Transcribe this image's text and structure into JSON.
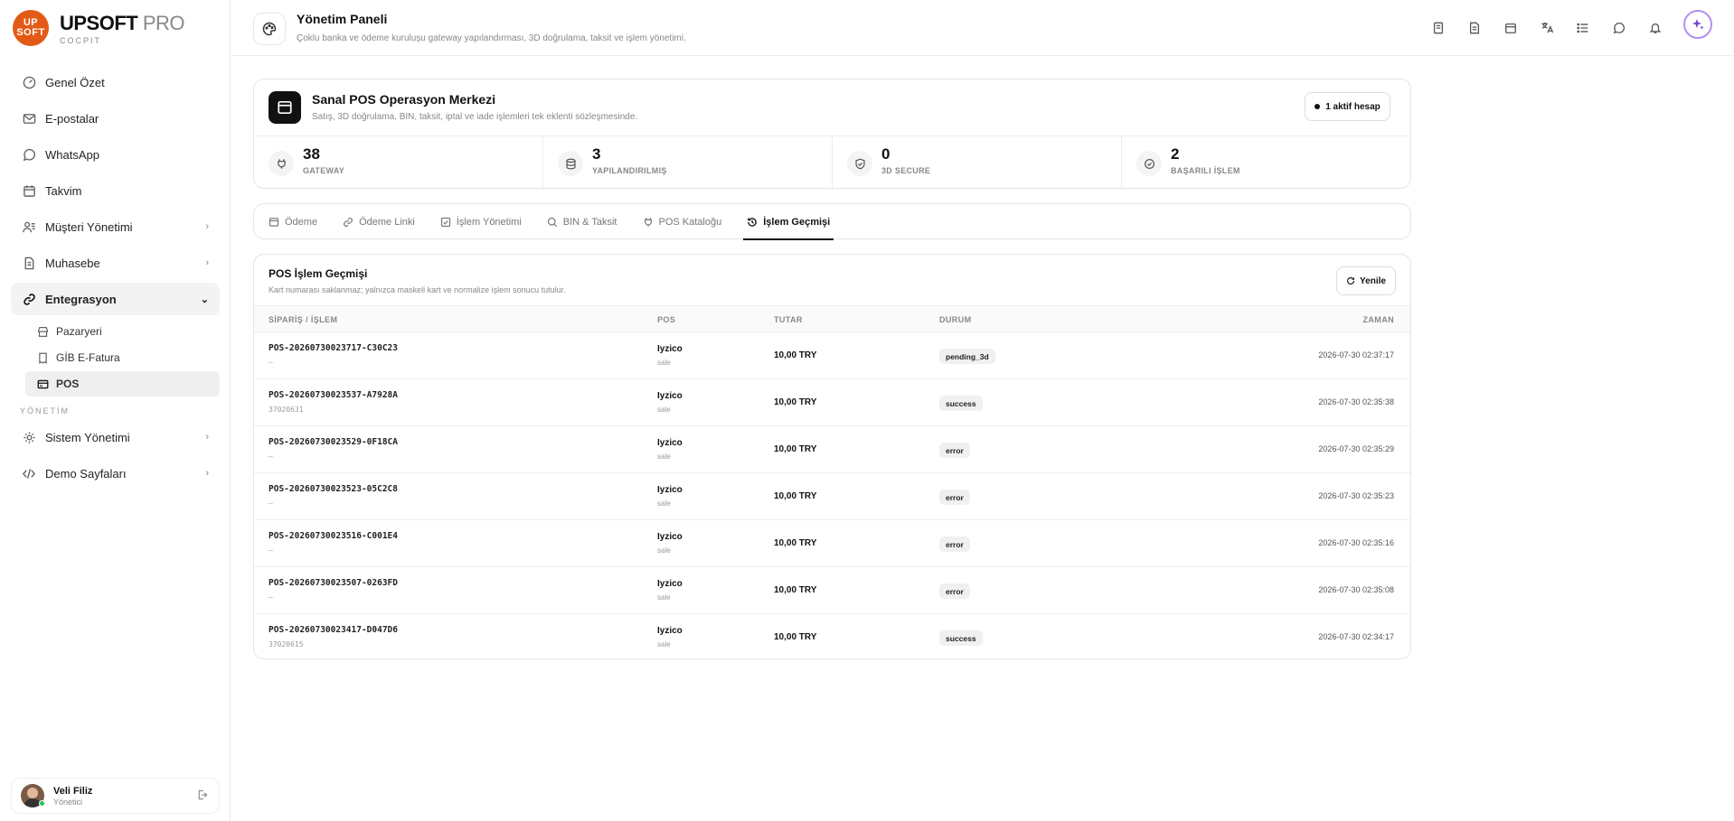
{
  "brand": {
    "logo_top": "UP",
    "logo_bottom": "SOFT",
    "name": "UPSOFT",
    "name_suffix": "PRO",
    "subtitle": "COCPIT"
  },
  "sidebar": {
    "items": [
      {
        "label": "Genel Özet",
        "icon": "gauge-icon"
      },
      {
        "label": "E-postalar",
        "icon": "mail-icon"
      },
      {
        "label": "WhatsApp",
        "icon": "whatsapp-icon"
      },
      {
        "label": "Takvim",
        "icon": "calendar-icon"
      },
      {
        "label": "Müşteri Yönetimi",
        "icon": "users-icon",
        "has_children": true
      },
      {
        "label": "Muhasebe",
        "icon": "document-icon",
        "has_children": true
      },
      {
        "label": "Entegrasyon",
        "icon": "link-icon",
        "expanded": true
      }
    ],
    "sub_items": [
      {
        "label": "Pazaryeri",
        "icon": "store-icon"
      },
      {
        "label": "GİB E-Fatura",
        "icon": "invoice-icon"
      },
      {
        "label": "POS",
        "icon": "card-icon",
        "active": true
      }
    ],
    "section_label": "YÖNETİM",
    "admin_items": [
      {
        "label": "Sistem Yönetimi",
        "icon": "gear-icon"
      },
      {
        "label": "Demo Sayfaları",
        "icon": "code-icon"
      }
    ]
  },
  "user": {
    "name": "Veli Filiz",
    "role": "Yönetici"
  },
  "topbar": {
    "title": "Yönetim Paneli",
    "subtitle": "Çoklu banka ve ödeme kuruluşu gateway yapılandırması, 3D doğrulama, taksit ve işlem yönetimi."
  },
  "hero": {
    "title": "Sanal POS Operasyon Merkezi",
    "subtitle": "Satış, 3D doğrulama, BIN, taksit, iptal ve iade işlemleri tek eklenti sözleşmesinde.",
    "badge": "1 aktif hesap",
    "stats": [
      {
        "value": "38",
        "label": "GATEWAY"
      },
      {
        "value": "3",
        "label": "YAPILANDIRILMIŞ"
      },
      {
        "value": "0",
        "label": "3D SECURE"
      },
      {
        "value": "2",
        "label": "BAŞARILI İŞLEM"
      }
    ]
  },
  "tabs": [
    {
      "label": "Ödeme"
    },
    {
      "label": "Ödeme Linki"
    },
    {
      "label": "İşlem Yönetimi"
    },
    {
      "label": "BIN & Taksit"
    },
    {
      "label": "POS Kataloğu"
    },
    {
      "label": "İşlem Geçmişi",
      "active": true
    }
  ],
  "history": {
    "title": "POS İşlem Geçmişi",
    "subtitle": "Kart numarası saklanmaz; yalnızca maskeli kart ve normalize işlem sonucu tutulur.",
    "refresh_label": "Yenile",
    "columns": {
      "order": "SİPARİŞ / İŞLEM",
      "pos": "POS",
      "amount": "TUTAR",
      "status": "DURUM",
      "time": "ZAMAN"
    },
    "rows": [
      {
        "order": "POS-20260730023717-C30C23",
        "sub": "–",
        "pos": "Iyzico",
        "type": "sale",
        "amount": "10,00 TRY",
        "status": "pending_3d",
        "time": "2026-07-30 02:37:17"
      },
      {
        "order": "POS-20260730023537-A7928A",
        "sub": "37020631",
        "pos": "Iyzico",
        "type": "sale",
        "amount": "10,00 TRY",
        "status": "success",
        "time": "2026-07-30 02:35:38"
      },
      {
        "order": "POS-20260730023529-0F18CA",
        "sub": "–",
        "pos": "Iyzico",
        "type": "sale",
        "amount": "10,00 TRY",
        "status": "error",
        "time": "2026-07-30 02:35:29"
      },
      {
        "order": "POS-20260730023523-05C2C8",
        "sub": "–",
        "pos": "Iyzico",
        "type": "sale",
        "amount": "10,00 TRY",
        "status": "error",
        "time": "2026-07-30 02:35:23"
      },
      {
        "order": "POS-20260730023516-C001E4",
        "sub": "–",
        "pos": "Iyzico",
        "type": "sale",
        "amount": "10,00 TRY",
        "status": "error",
        "time": "2026-07-30 02:35:16"
      },
      {
        "order": "POS-20260730023507-0263FD",
        "sub": "–",
        "pos": "Iyzico",
        "type": "sale",
        "amount": "10,00 TRY",
        "status": "error",
        "time": "2026-07-30 02:35:08"
      },
      {
        "order": "POS-20260730023417-D047D6",
        "sub": "37020615",
        "pos": "Iyzico",
        "type": "sale",
        "amount": "10,00 TRY",
        "status": "success",
        "time": "2026-07-30 02:34:17"
      }
    ]
  }
}
